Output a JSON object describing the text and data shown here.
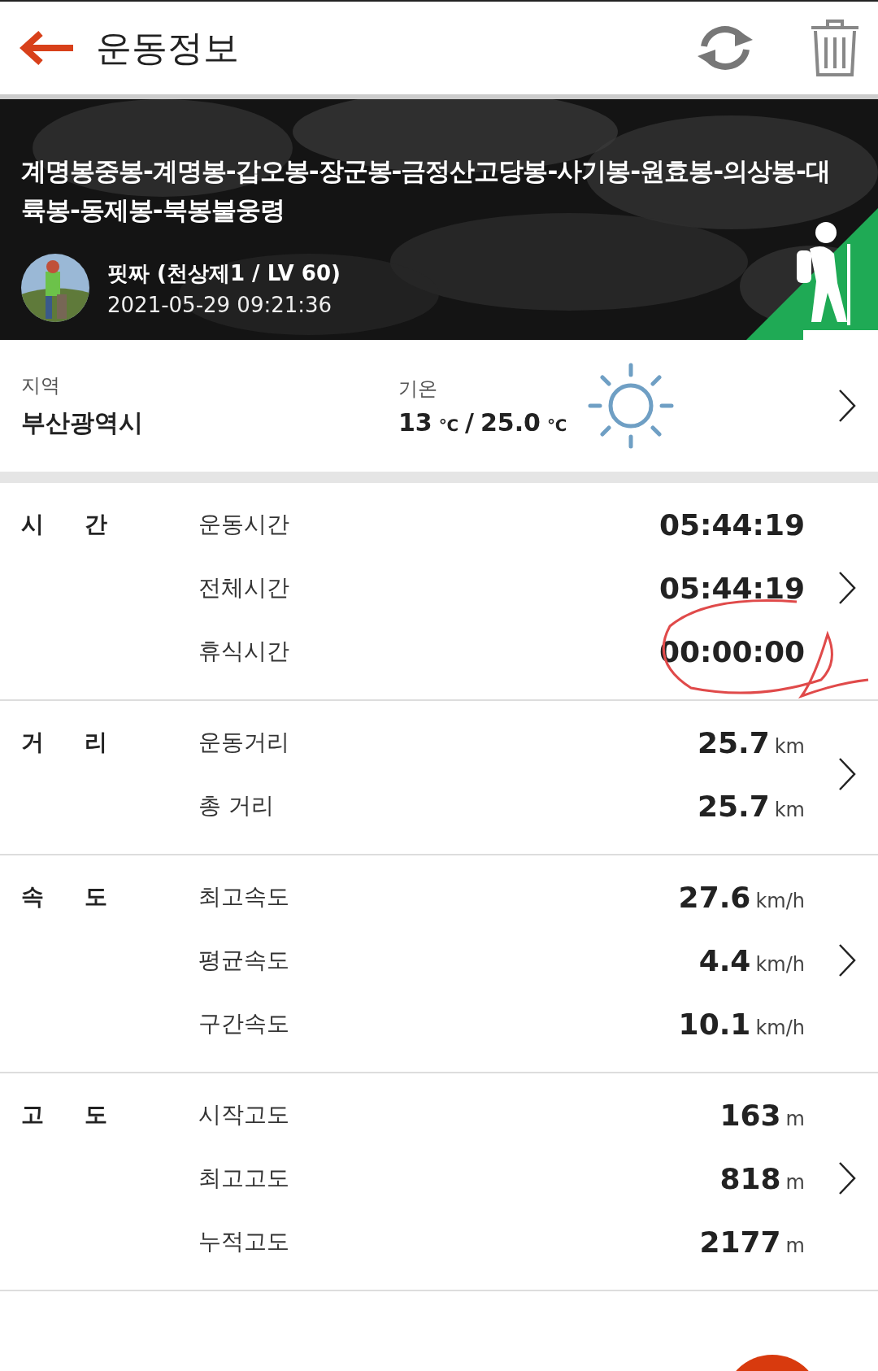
{
  "header": {
    "title": "운동정보"
  },
  "banner": {
    "route": "계명봉중봉-계명봉-갑오봉-장군봉-금정산고당봉-사기봉-원효봉-의상봉-대륙봉-동제봉-북봉불웅령",
    "user": "핏짜 (천상제1 / LV 60)",
    "datetime": "2021-05-29 09:21:36"
  },
  "region": {
    "label": "지역",
    "value": "부산광역시"
  },
  "weather": {
    "label": "기온",
    "separator": "/",
    "temps": [
      {
        "value": "13",
        "unit": "℃"
      },
      {
        "value": "25.0",
        "unit": "℃"
      }
    ]
  },
  "sections": [
    {
      "label": "시 간",
      "rows": [
        {
          "label": "운동시간",
          "value": "05:44:19",
          "circled": false
        },
        {
          "label": "전체시간",
          "value": "05:44:19",
          "circled": false
        },
        {
          "label": "휴식시간",
          "value": "00:00:00",
          "circled": true
        }
      ]
    },
    {
      "label": "거 리",
      "rows": [
        {
          "label": "운동거리",
          "value": "25.7",
          "unit": "km",
          "circled": false
        },
        {
          "label": "총 거리",
          "value": "25.7",
          "unit": "km",
          "circled": false
        }
      ]
    },
    {
      "label": "속 도",
      "rows": [
        {
          "label": "최고속도",
          "value": "27.6",
          "unit": "km/h",
          "circled": false
        },
        {
          "label": "평균속도",
          "value": "4.4",
          "unit": "km/h",
          "circled": false
        },
        {
          "label": "구간속도",
          "value": "10.1",
          "unit": "km/h",
          "circled": false
        }
      ]
    },
    {
      "label": "고 도",
      "rows": [
        {
          "label": "시작고도",
          "value": "163",
          "unit": "m",
          "circled": false
        },
        {
          "label": "최고고도",
          "value": "818",
          "unit": "m",
          "circled": false
        },
        {
          "label": "누적고도",
          "value": "2177",
          "unit": "m",
          "circled": false
        }
      ]
    }
  ]
}
